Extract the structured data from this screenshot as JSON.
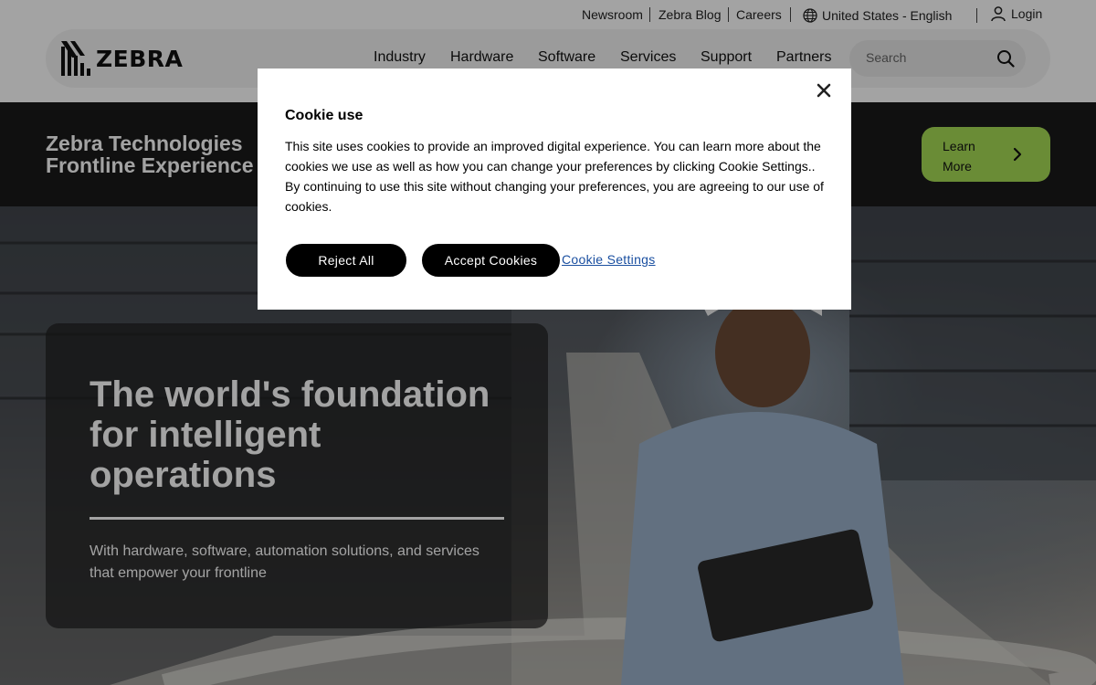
{
  "utility": {
    "newsroom": "Newsroom",
    "blog": "Zebra Blog",
    "careers": "Careers",
    "locale": "United States - English",
    "login": "Login"
  },
  "brand": {
    "name": "ZEBRA"
  },
  "nav": {
    "items": [
      "Industry",
      "Hardware",
      "Software",
      "Services",
      "Support",
      "Partners"
    ]
  },
  "search": {
    "placeholder": "Search"
  },
  "promo": {
    "title": "Zebra Technologies Frontline Experience",
    "button_label": "Learn More",
    "accent": "#a7dc55"
  },
  "hero": {
    "title": "The world's foundation for intelligent operations",
    "subtitle": "With hardware, software, automation solutions, and services that empower your frontline"
  },
  "cookie_modal": {
    "title": "Cookie use",
    "body": "This site uses cookies to provide an improved digital experience. You can learn more about the cookies we use as well as how you can change your preferences by clicking Cookie Settings.. By continuing to use this site without changing your preferences, you are agreeing to our use of cookies.",
    "reject_label": "Reject All",
    "accept_label": "Accept Cookies",
    "settings_label": "Cookie Settings",
    "link_color": "#1a4fa0"
  },
  "icons": [
    "globe-icon",
    "user-icon",
    "search-icon",
    "chevron-right-icon",
    "close-icon",
    "zebra-logo-icon"
  ]
}
